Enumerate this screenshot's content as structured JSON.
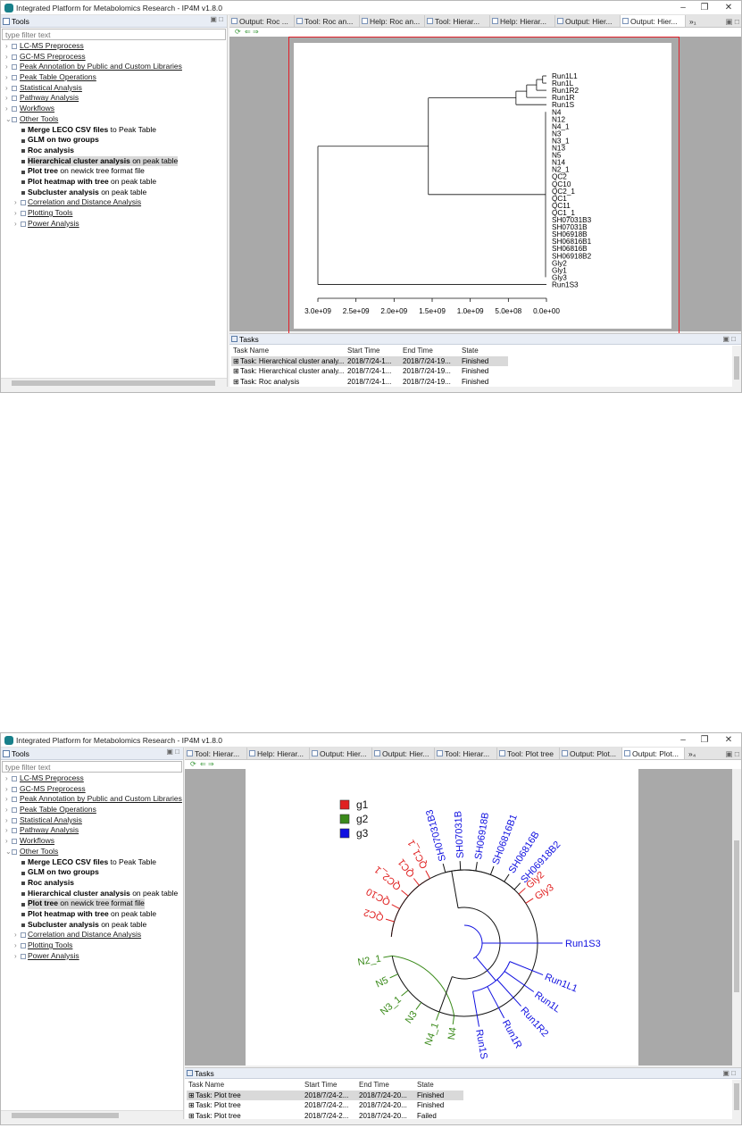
{
  "app": {
    "title": "Integrated Platform for Metabolomics Research - IP4M v1.8.0"
  },
  "tools_panel": {
    "title": "Tools",
    "filter_placeholder": "type filter text",
    "categories": [
      "LC-MS Preprocess",
      "GC-MS Preprocess",
      "Peak Annotation by Public and Custom Libraries",
      "Peak Table Operations",
      "Statistical Analysis",
      "Pathway Analysis",
      "Workflows",
      "Other Tools"
    ],
    "other_tools": [
      {
        "bold": "Merge LECO CSV files",
        "rest": " to Peak Table"
      },
      {
        "bold": "GLM on two groups",
        "rest": ""
      },
      {
        "bold": "Roc analysis",
        "rest": ""
      },
      {
        "bold": "Hierarchical cluster analysis",
        "rest": " on peak table"
      },
      {
        "bold": "Plot tree",
        "rest": " on newick tree format file"
      },
      {
        "bold": "Plot heatmap with tree",
        "rest": " on peak table"
      },
      {
        "bold": "Subcluster analysis",
        "rest": " on peak table"
      }
    ],
    "subcats": [
      "Correlation and Distance Analysis",
      "Plotting Tools",
      "Power Analysis"
    ]
  },
  "window1": {
    "tabs": [
      "Output: Roc ...",
      "Tool: Roc an...",
      "Help: Roc an...",
      "Tool: Hierar...",
      "Help: Hierar...",
      "Output: Hier...",
      "Output: Hier..."
    ],
    "overflow": "»₁",
    "tasks_title": "Tasks",
    "columns": [
      "Task Name",
      "Start Time",
      "End Time",
      "State"
    ],
    "rows": [
      [
        "Task: Hierarchical cluster analy...",
        "2018/7/24-1...",
        "2018/7/24-19...",
        "Finished"
      ],
      [
        "Task: Hierarchical cluster analy...",
        "2018/7/24-1...",
        "2018/7/24-19...",
        "Finished"
      ],
      [
        "Task: Roc analysis",
        "2018/7/24-1...",
        "2018/7/24-19...",
        "Finished"
      ]
    ]
  },
  "window2": {
    "tabs": [
      "Tool: Hierar...",
      "Help: Hierar...",
      "Output: Hier...",
      "Output: Hier...",
      "Tool: Hierar...",
      "Tool: Plot tree",
      "Output: Plot...",
      "Output: Plot..."
    ],
    "overflow": "»₄",
    "tasks_title": "Tasks",
    "columns": [
      "Task Name",
      "Start Time",
      "End Time",
      "State"
    ],
    "rows": [
      [
        "Task: Plot tree",
        "2018/7/24-2...",
        "2018/7/24-20...",
        "Finished"
      ],
      [
        "Task: Plot tree",
        "2018/7/24-2...",
        "2018/7/24-20...",
        "Finished"
      ],
      [
        "Task: Plot tree",
        "2018/7/24-2...",
        "2018/7/24-20...",
        "Failed"
      ]
    ]
  },
  "dendrogram": {
    "leaves": [
      "Run1L1",
      "Run1L",
      "Run1R2",
      "Run1R",
      "Run1S",
      "N4",
      "N12",
      "N4_1",
      "N3",
      "N3_1",
      "N13",
      "N5",
      "N14",
      "N2_1",
      "QC2",
      "QC10",
      "QC2_1",
      "QC1",
      "QC11",
      "QC1_1",
      "SH07031B3",
      "SH07031B",
      "SH06918B",
      "SH06816B1",
      "SH06816B",
      "SH06918B2",
      "Gly2",
      "Gly1",
      "Gly3",
      "Run1S3"
    ],
    "axis_ticks": [
      "3.0e+09",
      "2.5e+09",
      "2.0e+09",
      "1.5e+09",
      "1.0e+09",
      "5.0e+08",
      "0.0e+00"
    ]
  },
  "circular_tree": {
    "legend": [
      {
        "label": "g1",
        "color": "#e02020"
      },
      {
        "label": "g2",
        "color": "#3a8a1a"
      },
      {
        "label": "g3",
        "color": "#1010e0"
      }
    ],
    "labels_g1": [
      "QC1_1",
      "QC1",
      "QC2_1",
      "QC10",
      "QC2",
      "Gly2",
      "Gly3"
    ],
    "labels_g2": [
      "N2_1",
      "N5",
      "N3_1",
      "N3",
      "N4_1",
      "N4"
    ],
    "labels_g3": [
      "SH07031B3",
      "SH07031B",
      "SH06918B",
      "SH06816B1",
      "SH06816B",
      "SH06918B2",
      "Run1S3",
      "Run1L1",
      "Run1L",
      "Run1R2",
      "Run1R",
      "Run1S"
    ]
  }
}
